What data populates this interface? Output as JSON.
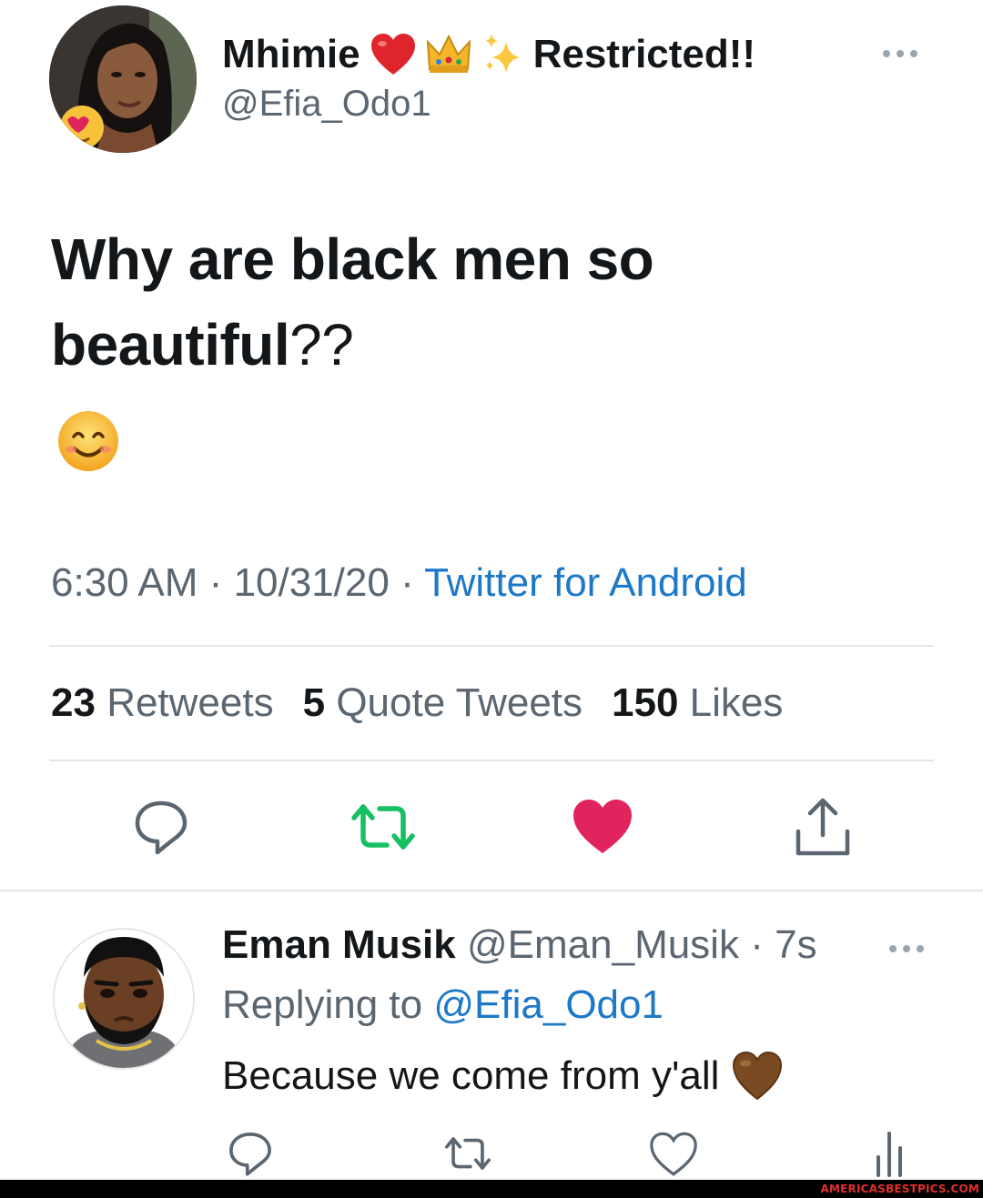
{
  "tweet": {
    "author": {
      "display_name": "Mhimie",
      "name_suffix": "Restricted!!",
      "name_emojis": [
        "red-heart-icon",
        "crown-icon",
        "sparkles-icon"
      ],
      "handle": "@Efia_Odo1"
    },
    "text_bold": "Why are black men so beautiful",
    "text_punct": "??",
    "text_emoji": "smiling-face-icon",
    "time": "6:30 AM",
    "date": "10/31/20",
    "separator": "·",
    "source": "Twitter for Android",
    "stats": {
      "retweets_count": "23",
      "retweets_label": "Retweets",
      "quotes_count": "5",
      "quotes_label": "Quote Tweets",
      "likes_count": "150",
      "likes_label": "Likes"
    },
    "actions": [
      "reply-icon",
      "retweet-icon",
      "like-icon",
      "share-icon"
    ],
    "liked": true,
    "retweeted": true
  },
  "reply": {
    "display_name": "Eman Musik",
    "handle": "@Eman_Musik",
    "separator": "·",
    "time": "7s",
    "replying_prefix": "Replying to",
    "replying_to": "@Efia_Odo1",
    "text": "Because we come from y'all",
    "text_emoji": "brown-heart-icon",
    "actions": [
      "reply-icon",
      "retweet-icon",
      "like-icon",
      "analytics-icon"
    ]
  },
  "watermark": "AMERICASBESTPICS.COM",
  "colors": {
    "text": "#14171a",
    "secondary": "#5b6670",
    "link": "#1d78c8",
    "retweet_green": "#17bf63",
    "like_red": "#e0245e",
    "divider": "#e3e7ea",
    "watermark_red": "#e0312a"
  }
}
